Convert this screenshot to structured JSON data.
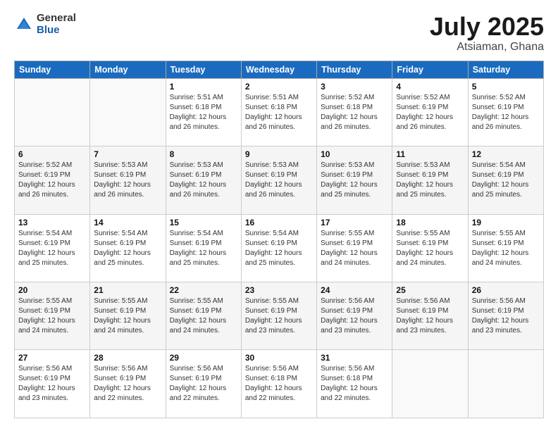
{
  "header": {
    "logo_general": "General",
    "logo_blue": "Blue",
    "title": "July 2025",
    "location": "Atsiaman, Ghana"
  },
  "days_of_week": [
    "Sunday",
    "Monday",
    "Tuesday",
    "Wednesday",
    "Thursday",
    "Friday",
    "Saturday"
  ],
  "weeks": [
    [
      {
        "day": "",
        "text": ""
      },
      {
        "day": "",
        "text": ""
      },
      {
        "day": "1",
        "text": "Sunrise: 5:51 AM\nSunset: 6:18 PM\nDaylight: 12 hours and 26 minutes."
      },
      {
        "day": "2",
        "text": "Sunrise: 5:51 AM\nSunset: 6:18 PM\nDaylight: 12 hours and 26 minutes."
      },
      {
        "day": "3",
        "text": "Sunrise: 5:52 AM\nSunset: 6:18 PM\nDaylight: 12 hours and 26 minutes."
      },
      {
        "day": "4",
        "text": "Sunrise: 5:52 AM\nSunset: 6:19 PM\nDaylight: 12 hours and 26 minutes."
      },
      {
        "day": "5",
        "text": "Sunrise: 5:52 AM\nSunset: 6:19 PM\nDaylight: 12 hours and 26 minutes."
      }
    ],
    [
      {
        "day": "6",
        "text": "Sunrise: 5:52 AM\nSunset: 6:19 PM\nDaylight: 12 hours and 26 minutes."
      },
      {
        "day": "7",
        "text": "Sunrise: 5:53 AM\nSunset: 6:19 PM\nDaylight: 12 hours and 26 minutes."
      },
      {
        "day": "8",
        "text": "Sunrise: 5:53 AM\nSunset: 6:19 PM\nDaylight: 12 hours and 26 minutes."
      },
      {
        "day": "9",
        "text": "Sunrise: 5:53 AM\nSunset: 6:19 PM\nDaylight: 12 hours and 26 minutes."
      },
      {
        "day": "10",
        "text": "Sunrise: 5:53 AM\nSunset: 6:19 PM\nDaylight: 12 hours and 25 minutes."
      },
      {
        "day": "11",
        "text": "Sunrise: 5:53 AM\nSunset: 6:19 PM\nDaylight: 12 hours and 25 minutes."
      },
      {
        "day": "12",
        "text": "Sunrise: 5:54 AM\nSunset: 6:19 PM\nDaylight: 12 hours and 25 minutes."
      }
    ],
    [
      {
        "day": "13",
        "text": "Sunrise: 5:54 AM\nSunset: 6:19 PM\nDaylight: 12 hours and 25 minutes."
      },
      {
        "day": "14",
        "text": "Sunrise: 5:54 AM\nSunset: 6:19 PM\nDaylight: 12 hours and 25 minutes."
      },
      {
        "day": "15",
        "text": "Sunrise: 5:54 AM\nSunset: 6:19 PM\nDaylight: 12 hours and 25 minutes."
      },
      {
        "day": "16",
        "text": "Sunrise: 5:54 AM\nSunset: 6:19 PM\nDaylight: 12 hours and 25 minutes."
      },
      {
        "day": "17",
        "text": "Sunrise: 5:55 AM\nSunset: 6:19 PM\nDaylight: 12 hours and 24 minutes."
      },
      {
        "day": "18",
        "text": "Sunrise: 5:55 AM\nSunset: 6:19 PM\nDaylight: 12 hours and 24 minutes."
      },
      {
        "day": "19",
        "text": "Sunrise: 5:55 AM\nSunset: 6:19 PM\nDaylight: 12 hours and 24 minutes."
      }
    ],
    [
      {
        "day": "20",
        "text": "Sunrise: 5:55 AM\nSunset: 6:19 PM\nDaylight: 12 hours and 24 minutes."
      },
      {
        "day": "21",
        "text": "Sunrise: 5:55 AM\nSunset: 6:19 PM\nDaylight: 12 hours and 24 minutes."
      },
      {
        "day": "22",
        "text": "Sunrise: 5:55 AM\nSunset: 6:19 PM\nDaylight: 12 hours and 24 minutes."
      },
      {
        "day": "23",
        "text": "Sunrise: 5:55 AM\nSunset: 6:19 PM\nDaylight: 12 hours and 23 minutes."
      },
      {
        "day": "24",
        "text": "Sunrise: 5:56 AM\nSunset: 6:19 PM\nDaylight: 12 hours and 23 minutes."
      },
      {
        "day": "25",
        "text": "Sunrise: 5:56 AM\nSunset: 6:19 PM\nDaylight: 12 hours and 23 minutes."
      },
      {
        "day": "26",
        "text": "Sunrise: 5:56 AM\nSunset: 6:19 PM\nDaylight: 12 hours and 23 minutes."
      }
    ],
    [
      {
        "day": "27",
        "text": "Sunrise: 5:56 AM\nSunset: 6:19 PM\nDaylight: 12 hours and 23 minutes."
      },
      {
        "day": "28",
        "text": "Sunrise: 5:56 AM\nSunset: 6:19 PM\nDaylight: 12 hours and 22 minutes."
      },
      {
        "day": "29",
        "text": "Sunrise: 5:56 AM\nSunset: 6:19 PM\nDaylight: 12 hours and 22 minutes."
      },
      {
        "day": "30",
        "text": "Sunrise: 5:56 AM\nSunset: 6:18 PM\nDaylight: 12 hours and 22 minutes."
      },
      {
        "day": "31",
        "text": "Sunrise: 5:56 AM\nSunset: 6:18 PM\nDaylight: 12 hours and 22 minutes."
      },
      {
        "day": "",
        "text": ""
      },
      {
        "day": "",
        "text": ""
      }
    ]
  ]
}
